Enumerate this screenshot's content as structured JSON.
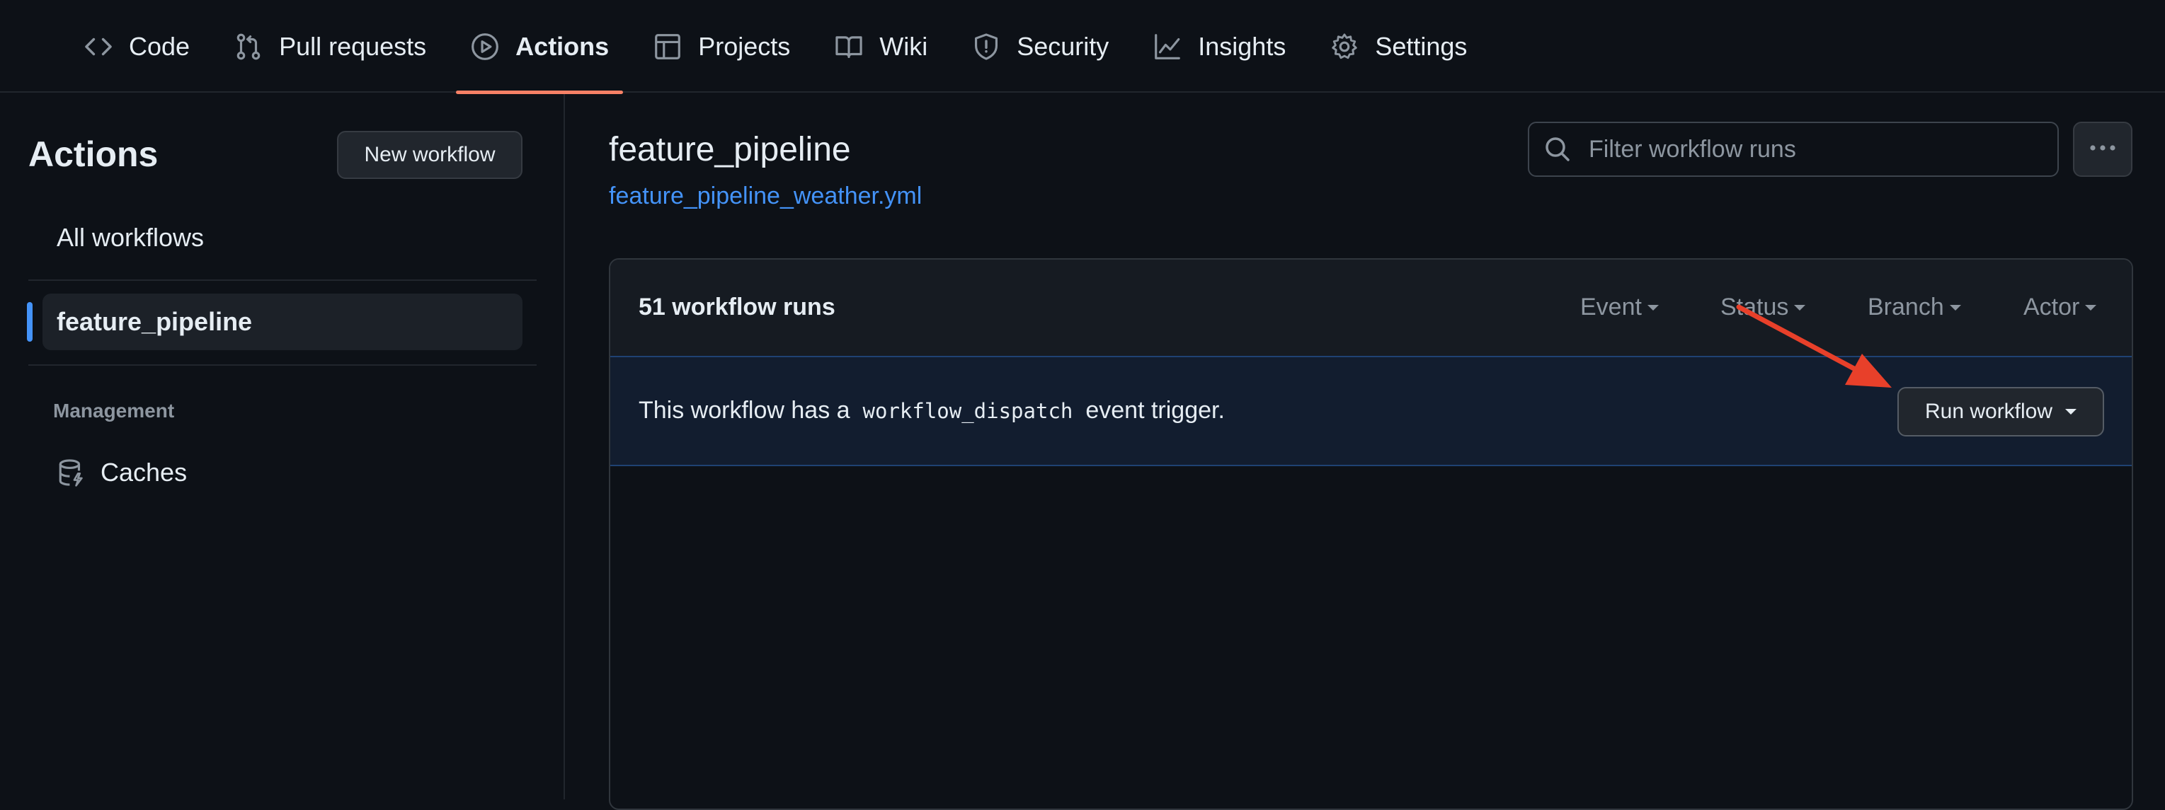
{
  "nav": {
    "tabs": [
      {
        "label": "Code",
        "icon": "code-icon"
      },
      {
        "label": "Pull requests",
        "icon": "git-pull-request-icon"
      },
      {
        "label": "Actions",
        "icon": "play-icon",
        "active": true
      },
      {
        "label": "Projects",
        "icon": "table-icon"
      },
      {
        "label": "Wiki",
        "icon": "book-icon"
      },
      {
        "label": "Security",
        "icon": "shield-icon"
      },
      {
        "label": "Insights",
        "icon": "graph-icon"
      },
      {
        "label": "Settings",
        "icon": "gear-icon"
      }
    ]
  },
  "sidebar": {
    "title": "Actions",
    "new_workflow_label": "New workflow",
    "all_workflows_label": "All workflows",
    "active_workflow_label": "feature_pipeline",
    "management_heading": "Management",
    "caches_label": "Caches"
  },
  "main": {
    "workflow_title": "feature_pipeline",
    "workflow_file": "feature_pipeline_weather.yml",
    "filter_placeholder": "Filter workflow runs",
    "runs_count": "51 workflow runs",
    "filters": [
      "Event",
      "Status",
      "Branch",
      "Actor"
    ],
    "dispatch": {
      "prefix": "This workflow has a",
      "code": "workflow_dispatch",
      "suffix": "event trigger."
    },
    "run_workflow_label": "Run workflow"
  },
  "colors": {
    "background": "#0d1117",
    "active_tab_underline": "#f78166",
    "link": "#4493f8",
    "annotation_arrow": "#e8402a"
  }
}
